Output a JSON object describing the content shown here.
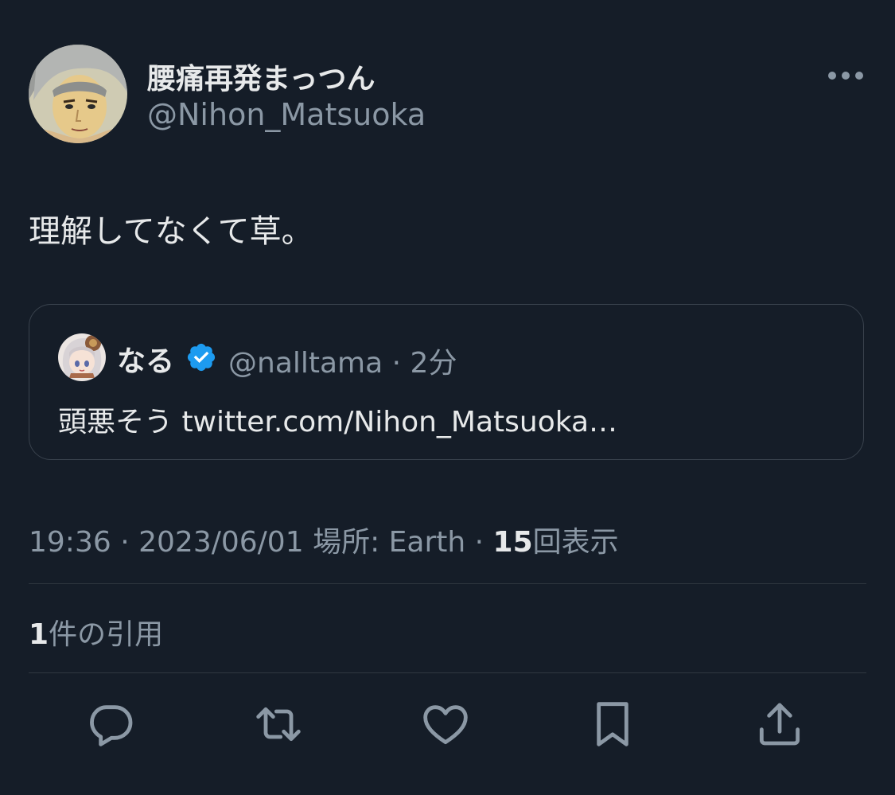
{
  "tweet": {
    "display_name": "腰痛再発まっつん",
    "handle": "@Nihon_Matsuoka",
    "text": "理解してなくて草。",
    "more_icon": "more-horizontal-icon",
    "avatar": "avatar-anime-character"
  },
  "quote": {
    "name": "なる",
    "verified_icon": "verified-badge-icon",
    "handle": "@nalltama",
    "separator": "·",
    "time": "2分",
    "text": "頭悪そう twitter.com/Nihon_Matsuoka…"
  },
  "meta": {
    "time": "19:36",
    "separator": "·",
    "date": "2023/06/01",
    "location_label": "場所: Earth",
    "views_count": "15",
    "views_label": "回表示"
  },
  "stats": {
    "quotes_count": "1",
    "quotes_label": "件の引用"
  },
  "actions": {
    "reply_icon": "reply-icon",
    "retweet_icon": "retweet-icon",
    "like_icon": "heart-icon",
    "bookmark_icon": "bookmark-icon",
    "share_icon": "share-icon"
  },
  "colors": {
    "background": "#151d28",
    "primary_text": "#e7e9ea",
    "secondary_text": "#8b98a5",
    "border": "#39424d",
    "verified": "#1d9bf0"
  }
}
